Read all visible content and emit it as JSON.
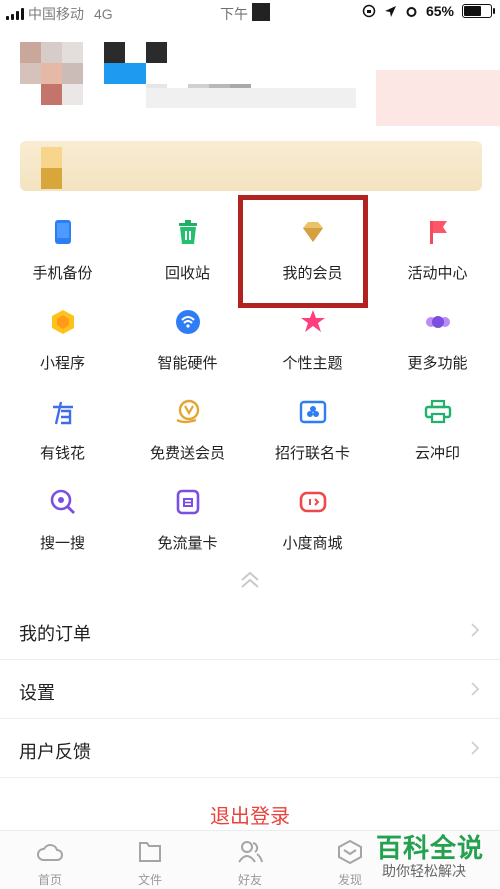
{
  "status_bar": {
    "carrier": "中国移动",
    "network": "4G",
    "time": "下午",
    "battery": "65%"
  },
  "grid": {
    "items": [
      {
        "label": "手机备份",
        "icon": "phone-backup-icon"
      },
      {
        "label": "回收站",
        "icon": "recycle-bin-icon"
      },
      {
        "label": "我的会员",
        "icon": "membership-diamond-icon"
      },
      {
        "label": "活动中心",
        "icon": "activity-flag-icon"
      },
      {
        "label": "小程序",
        "icon": "mini-program-icon"
      },
      {
        "label": "智能硬件",
        "icon": "smart-hardware-icon"
      },
      {
        "label": "个性主题",
        "icon": "theme-star-icon"
      },
      {
        "label": "更多功能",
        "icon": "more-functions-icon"
      },
      {
        "label": "有钱花",
        "icon": "youqianhua-icon"
      },
      {
        "label": "免费送会员",
        "icon": "free-membership-icon"
      },
      {
        "label": "招行联名卡",
        "icon": "bank-card-icon"
      },
      {
        "label": "云冲印",
        "icon": "cloud-print-icon"
      },
      {
        "label": "搜一搜",
        "icon": "search-icon"
      },
      {
        "label": "免流量卡",
        "icon": "data-card-icon"
      },
      {
        "label": "小度商城",
        "icon": "xiaodu-store-icon"
      }
    ]
  },
  "menu": {
    "orders": "我的订单",
    "settings": "设置",
    "feedback": "用户反馈",
    "logout": "退出登录"
  },
  "tabbar": {
    "home": "首页",
    "files": "文件",
    "friends": "好友",
    "discover": "发现"
  },
  "watermark": {
    "title": "百科全说",
    "subtitle": "助你轻松解决"
  },
  "colors": {
    "highlight_border": "#b2221e",
    "logout": "#e8433c",
    "watermark": "#24a14f"
  }
}
